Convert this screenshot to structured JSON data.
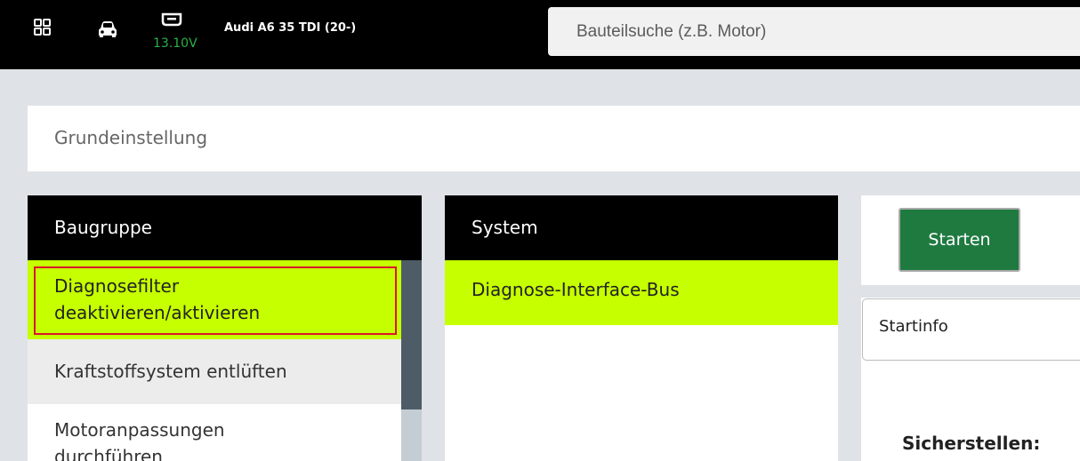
{
  "topbar": {
    "icons": [
      "grid-icon",
      "car-icon",
      "battery-icon"
    ],
    "voltage": "13.10V",
    "voltage_color": "#27b24a",
    "vehicle": "Audi A6 35 TDI (20-)",
    "search_placeholder": "Bauteilsuche (z.B. Motor)"
  },
  "page": {
    "title": "Grundeinstellung"
  },
  "baugruppe": {
    "header": "Baugruppe",
    "items": [
      {
        "line1": "Diagnosefilter",
        "line2": "deaktivieren/aktivieren",
        "selected": true
      },
      {
        "line1": "Kraftstoffsystem entlüften",
        "line2": ""
      },
      {
        "line1": "Motoranpassungen",
        "line2": "durchführen"
      }
    ]
  },
  "system": {
    "header": "System",
    "items": [
      {
        "label": "Diagnose-Interface-Bus",
        "selected": true
      }
    ]
  },
  "actions": {
    "start_label": "Starten",
    "startinfo_label": "Startinfo",
    "ensure_label": "Sicherstellen:"
  },
  "colors": {
    "selection": "#c6ff00",
    "start_button": "#1f7a40",
    "highlight_border": "#d9162a"
  }
}
